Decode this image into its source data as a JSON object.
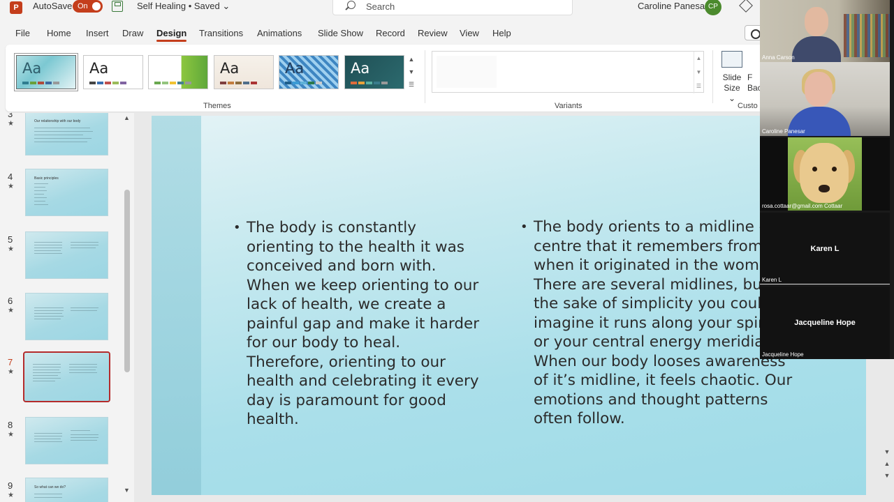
{
  "titlebar": {
    "logo": "P",
    "autosave_label": "AutoSave",
    "autosave_state": "On",
    "document_title": "Self Healing • Saved ⌄",
    "search_placeholder": "Search",
    "user_name": "Caroline Panesar",
    "user_initials": "CP"
  },
  "tabs": [
    "File",
    "Home",
    "Insert",
    "Draw",
    "Design",
    "Transitions",
    "Animations",
    "Slide Show",
    "Record",
    "Review",
    "View",
    "Help"
  ],
  "active_tab": "Design",
  "ribbon": {
    "themes_label": "Themes",
    "variants_label": "Variants",
    "themes": [
      {
        "aa": "Aa",
        "bg": "linear",
        "color": "#2f5d6b"
      },
      {
        "aa": "Aa",
        "bg": "white",
        "color": "#222222"
      },
      {
        "aa": "Aa",
        "bg": "green",
        "color": "#ffffff"
      },
      {
        "aa": "Aa",
        "bg": "beige",
        "color": "#222222"
      },
      {
        "aa": "Aa",
        "bg": "pattern",
        "color": "#1f3a5a"
      },
      {
        "aa": "Aa",
        "bg": "dark",
        "color": "#ffffff"
      }
    ],
    "slide_size_line1": "Slide",
    "slide_size_line2": "Size ⌄",
    "format_bg_line1": "F",
    "format_bg_line2": "Bac",
    "customize_label": "Custo"
  },
  "thumbnails": [
    {
      "num": "3",
      "title": "Our relationship with our body",
      "active": false
    },
    {
      "num": "4",
      "title": "Basic principles",
      "active": false
    },
    {
      "num": "5",
      "title": "",
      "active": false
    },
    {
      "num": "6",
      "title": "",
      "active": false
    },
    {
      "num": "7",
      "title": "",
      "active": true
    },
    {
      "num": "8",
      "title": "",
      "active": false
    },
    {
      "num": "9",
      "title": "So what can we do?",
      "active": false
    }
  ],
  "slide": {
    "left_text": "The body is constantly orienting to the health it was conceived and born with. When we keep orienting to our lack of health, we create a painful gap and make it harder for our body to heal. Therefore, orienting to our health and celebrating it every day is paramount for good health.",
    "left_lines": [
      "The body is constantly",
      "orienting to the health it was",
      "conceived and born with.",
      "When we keep orienting to our",
      "lack of health, we create a",
      "painful gap and make it harder",
      "for our body to heal.",
      "Therefore, orienting to our",
      "health and celebrating it every",
      "day is paramount for good",
      "health."
    ],
    "right_lines": [
      "The body orients to a midline –",
      "centre that it remembers from",
      "when it originated in the womb",
      "There are several midlines, but for",
      "the sake of simplicity you could",
      "imagine it runs along your spine",
      "or your central energy meridian.",
      "When our body looses awareness",
      "of it’s midline, it feels chaotic. Our",
      "emotions and thought patterns",
      "often follow."
    ]
  },
  "participants": [
    {
      "name": "Anna Carson",
      "type": "video"
    },
    {
      "name": "Caroline Panesar",
      "type": "video"
    },
    {
      "name": "rosa.cottaar@gmail.com Cottaar",
      "type": "image"
    },
    {
      "name": "Karen L",
      "type": "name"
    },
    {
      "name": "Jacqueline Hope",
      "type": "name"
    }
  ]
}
